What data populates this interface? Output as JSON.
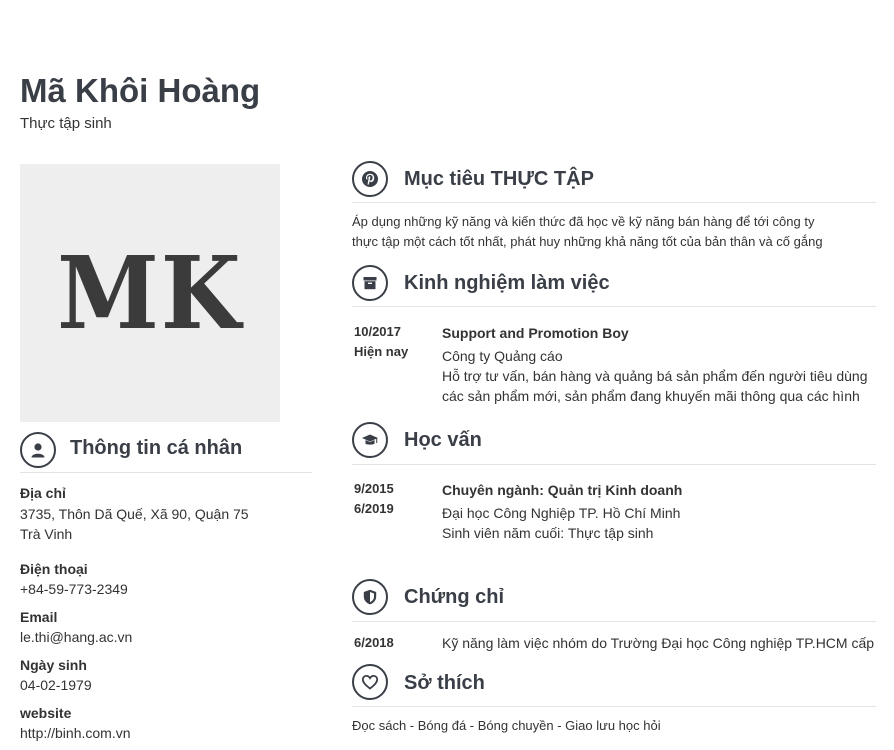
{
  "profile": {
    "name": "Mã Khôi Hoàng",
    "title": "Thực tập sinh",
    "initials": "MK"
  },
  "personal": {
    "heading": "Thông tin cá nhân",
    "address_label": "Địa chỉ",
    "address_line1": "3735, Thôn Dã Quế, Xã 90, Quận 75",
    "address_line2": "Trà Vinh",
    "phone_label": "Điện thoại",
    "phone": "+84-59-773-2349",
    "email_label": "Email",
    "email": "le.thi@hang.ac.vn",
    "birth_label": "Ngày sinh",
    "birth": "04-02-1979",
    "website_label": "website",
    "website": "http://binh.com.vn"
  },
  "objective": {
    "heading": "Mục tiêu THỰC TẬP",
    "line1": "Áp dụng những kỹ năng và kiến thức đã học về kỹ năng bán hàng để tới công ty",
    "line2": "thực tập một cách tốt nhất, phát huy những khả năng tốt của bản thân và cố gắng"
  },
  "experience": {
    "heading": "Kinh nghiệm làm việc",
    "from": "10/2017",
    "to": "Hiện nay",
    "role": "Support and Promotion Boy",
    "company": "Công ty Quảng cáo",
    "desc1": "Hỗ trợ tư vấn, bán hàng và quảng bá sản phẩm đến người tiêu dùng",
    "desc2": "các sản phẩm mới, sản phẩm đang khuyến mãi thông qua các hình"
  },
  "education": {
    "heading": "Học vấn",
    "from": "9/2015",
    "to": "6/2019",
    "major": "Chuyên ngành: Quản trị Kinh doanh",
    "school": "Đại học Công Nghiệp TP. Hồ Chí Minh",
    "note": "Sinh viên năm cuối: Thực tập sinh"
  },
  "certificates": {
    "heading": "Chứng chỉ",
    "date": "6/2018",
    "text": "Kỹ năng làm việc nhóm do Trường Đại học Công nghiệp TP.HCM cấp"
  },
  "hobbies": {
    "heading": "Sở thích",
    "text": "Đọc sách - Bóng đá - Bóng chuyền - Giao lưu học hỏi"
  },
  "icons": {
    "personal": "user-icon",
    "objective": "pinterest-icon",
    "experience": "archive-box-icon",
    "education": "graduation-cap-icon",
    "certificates": "shield-icon",
    "hobbies": "heart-icon"
  },
  "colors": {
    "heading": "#3a3f47",
    "avatar_bg": "#eeeeee",
    "rule": "#e4e4e4"
  }
}
